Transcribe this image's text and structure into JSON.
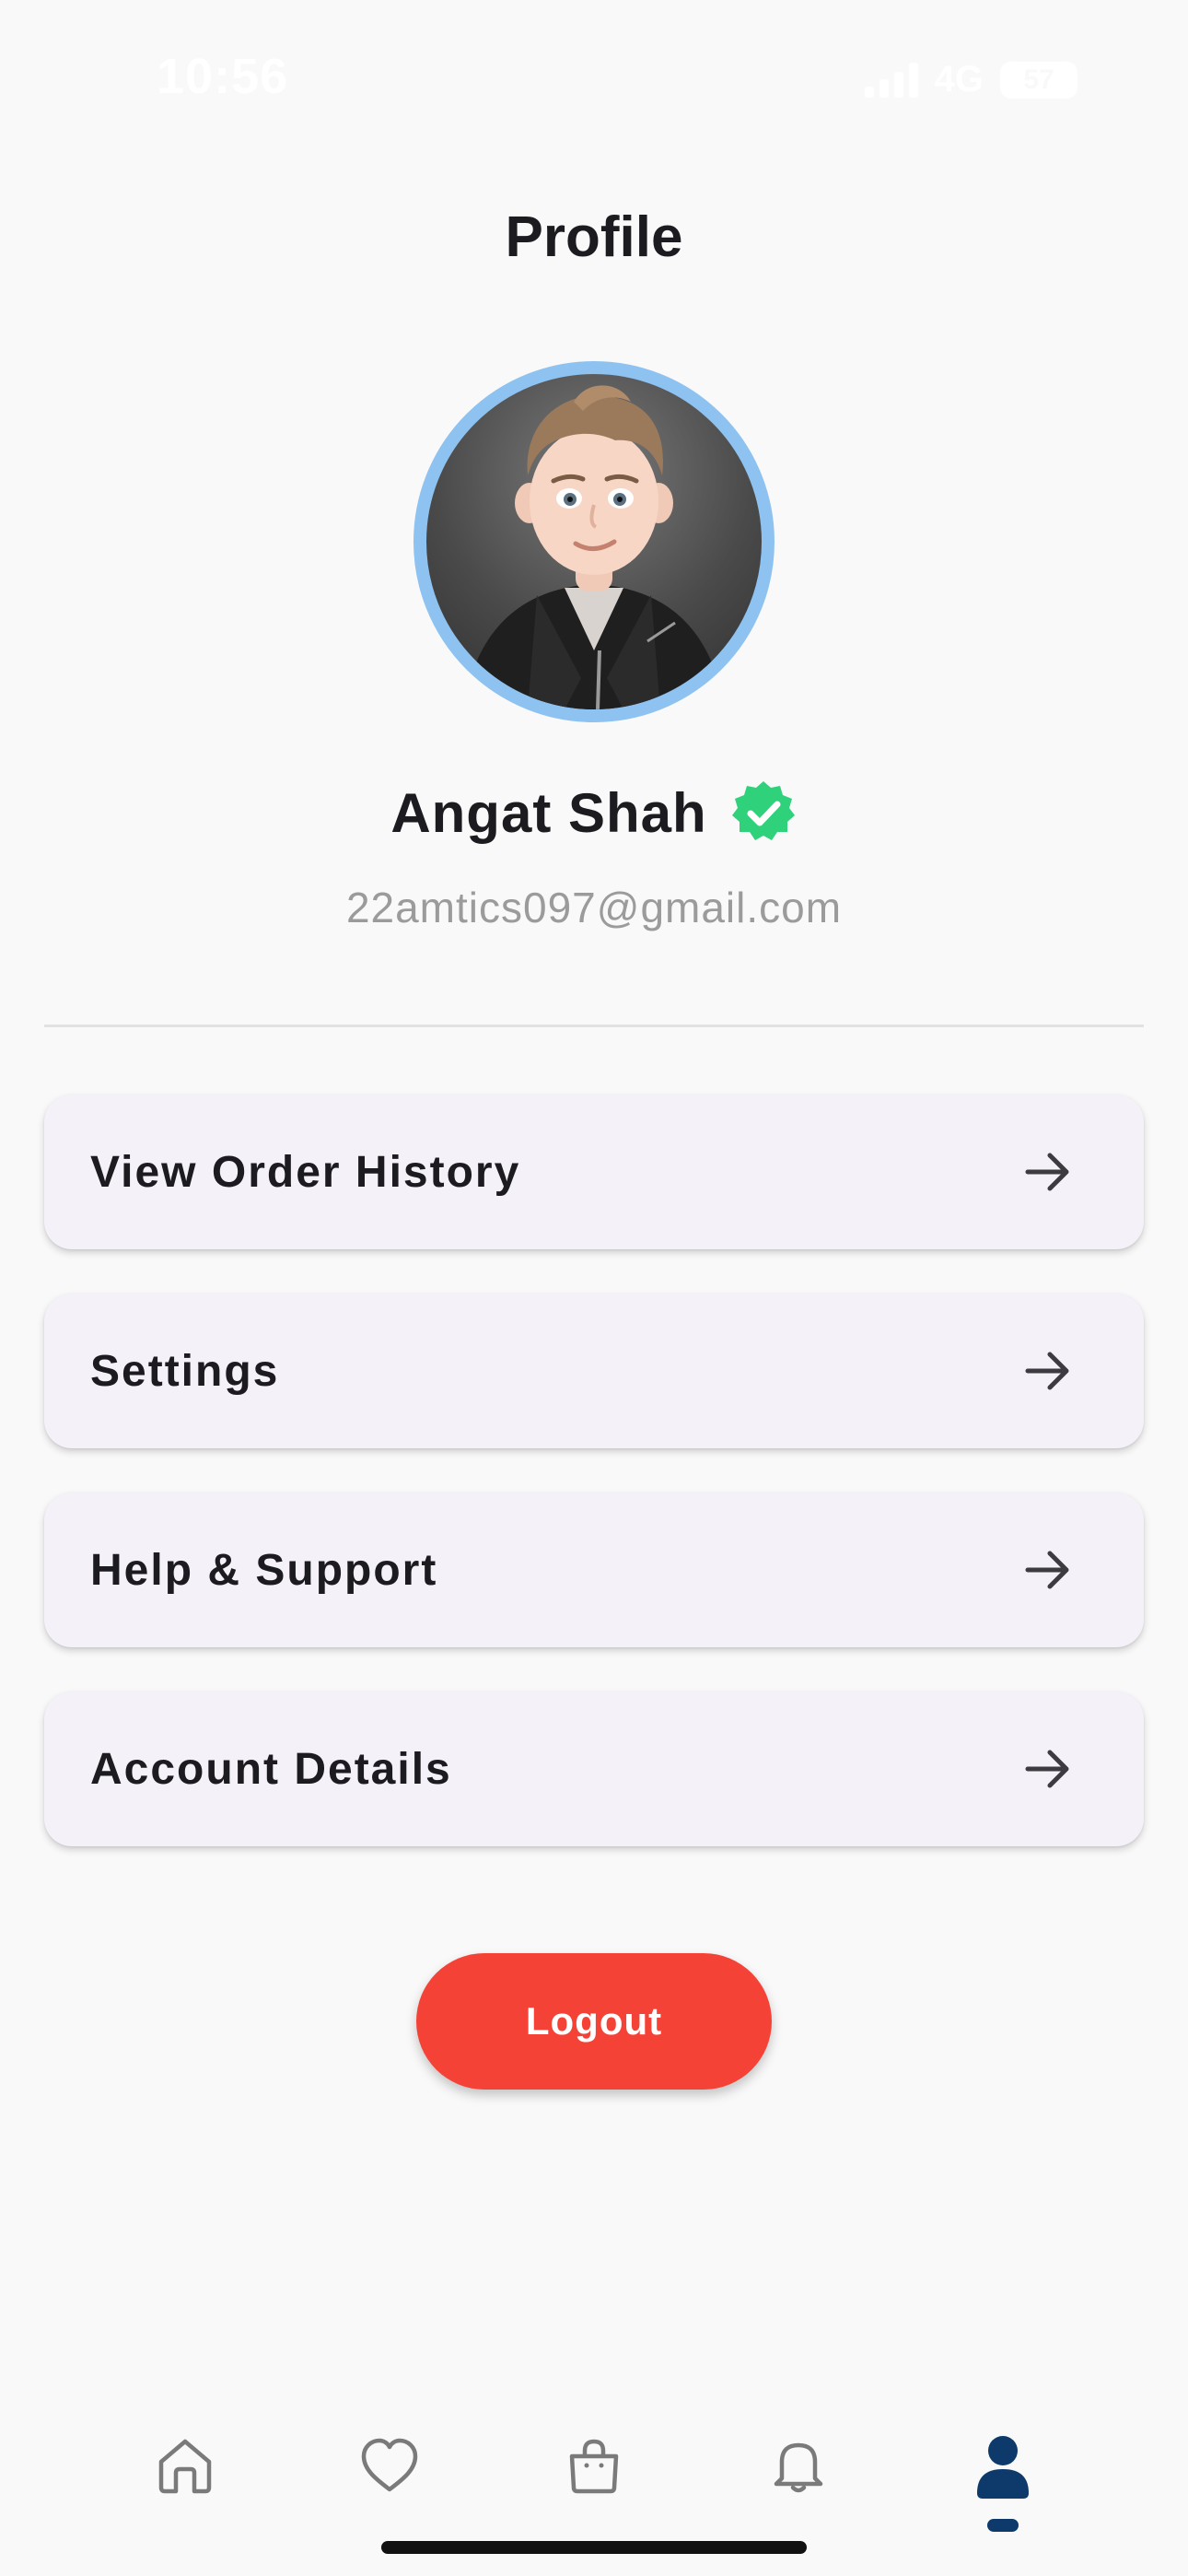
{
  "status_bar": {
    "time": "10:56",
    "network": "4G",
    "battery": "57"
  },
  "page": {
    "title": "Profile"
  },
  "profile": {
    "name": "Angat Shah",
    "email": "22amtics097@gmail.com",
    "verified": true
  },
  "menu": {
    "items": [
      {
        "label": "View Order History"
      },
      {
        "label": "Settings"
      },
      {
        "label": "Help & Support"
      },
      {
        "label": "Account Details"
      }
    ]
  },
  "logout": {
    "label": "Logout"
  },
  "bottom_nav": {
    "items": [
      {
        "icon": "home-icon"
      },
      {
        "icon": "heart-icon"
      },
      {
        "icon": "shopping-bag-icon"
      },
      {
        "icon": "bell-icon"
      },
      {
        "icon": "person-icon",
        "active": true
      }
    ]
  },
  "colors": {
    "accent": "#0d3a6b",
    "logout": "#f44336",
    "avatar_ring": "#8ec2f0",
    "verified": "#2fd17a",
    "card": "#f5f1f8"
  }
}
